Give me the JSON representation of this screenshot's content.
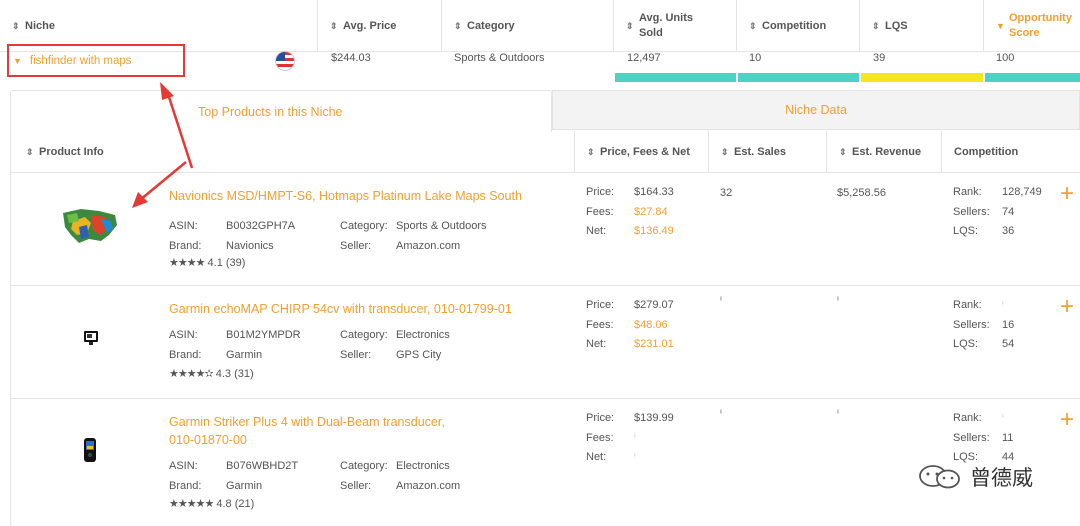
{
  "niche_header": {
    "niche": "Niche",
    "avg_price": "Avg. Price",
    "category": "Category",
    "avg_units_1": "Avg. Units",
    "avg_units_2": "Sold",
    "competition": "Competition",
    "lqs": "LQS",
    "opportunity_1": "Opportunity",
    "opportunity_2": "Score"
  },
  "niche_row": {
    "name": "fishfinder with maps",
    "flag_icon": "us-flag-icon",
    "avg_price": "$244.03",
    "category": "Sports & Outdoors",
    "units": "12,497",
    "competition": "10",
    "lqs": "39",
    "opportunity": "100",
    "bar_colors": {
      "units": "#4fd1c5",
      "competition": "#4fd1c5",
      "lqs": "#f5e623",
      "opportunity": "#4fd1c5"
    }
  },
  "tabs": {
    "top_products": "Top Products in this Niche",
    "niche_data": "Niche Data"
  },
  "product_header": {
    "info": "Product Info",
    "price": "Price, Fees & Net",
    "sales": "Est. Sales",
    "revenue": "Est. Revenue",
    "competition": "Competition"
  },
  "labels": {
    "asin": "ASIN:",
    "brand": "Brand:",
    "category": "Category:",
    "seller": "Seller:",
    "price": "Price:",
    "fees": "Fees:",
    "net": "Net:",
    "rank": "Rank:",
    "sellers": "Sellers:",
    "lqs": "LQS:"
  },
  "products": [
    {
      "title": "Navionics MSD/HMPT-S6, Hotmaps Platinum Lake Maps South",
      "asin": "B0032GPH7A",
      "brand": "Navionics",
      "category": "Sports & Outdoors",
      "seller": "Amazon.com",
      "stars": "★★★★",
      "rating": "4.1 (39)",
      "price": "$164.33",
      "fees": "$27.84",
      "net": "$136.49",
      "sales": "32",
      "revenue": "$5,258.56",
      "rank": "128,749",
      "sellers": "74",
      "lqs": "36"
    },
    {
      "title": "Garmin echoMAP CHIRP 54cv with transducer, 010-01799-01",
      "asin": "B01M2YMPDR",
      "brand": "Garmin",
      "category": "Electronics",
      "seller": "GPS City",
      "stars": "★★★★✫",
      "rating": "4.3 (31)",
      "price": "$279.07",
      "fees": "$48.06",
      "net": "$231.01",
      "sales": "ⁱ",
      "revenue": "ⁱ",
      "rank": "ⁱ",
      "sellers": "16",
      "lqs": "54"
    },
    {
      "title_1": "Garmin Striker Plus 4 with Dual-Beam transducer,",
      "title_2": "010-01870-00",
      "asin": "B076WBHD2T",
      "brand": "Garmin",
      "category": "Electronics",
      "seller": "Amazon.com",
      "stars": "★★★★★",
      "rating": "4.8 (21)",
      "price": "$139.99",
      "fees": "ⁱ",
      "net": "ⁱ",
      "sales": "ⁱ",
      "revenue": "ⁱ",
      "rank": "ⁱ",
      "sellers": "11",
      "lqs": "44"
    }
  ],
  "watermark": {
    "text": "曾德威",
    "icon": "wechat-icon"
  },
  "annotation": {
    "box_color": "#e53935",
    "arrow_color": "#e53935"
  }
}
